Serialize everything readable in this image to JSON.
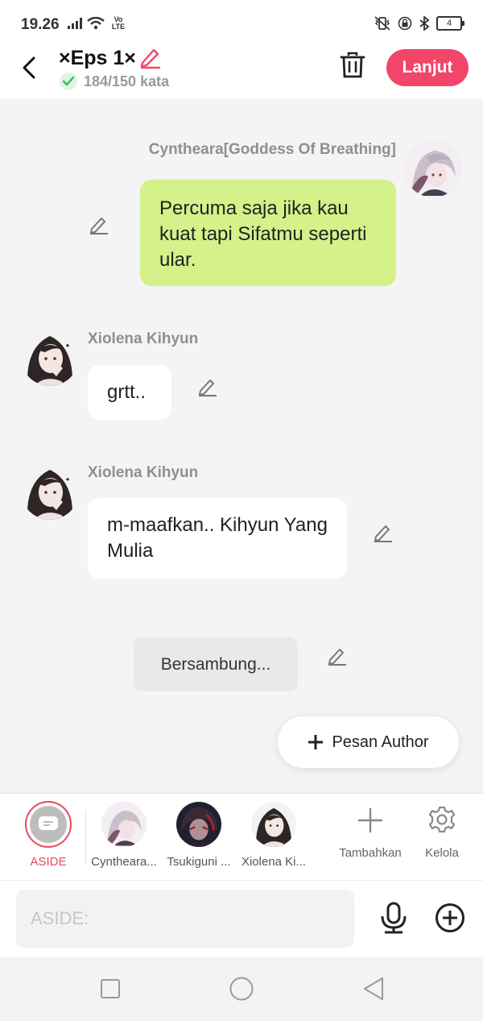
{
  "status_bar": {
    "time": "19.26",
    "network": "Vo LTE",
    "battery": "4"
  },
  "header": {
    "title": "×Eps 1×",
    "word_count": "184/150 kata",
    "next_label": "Lanjut",
    "accent_color": "#f2456a"
  },
  "messages": [
    {
      "sender": "Cyntheara[Goddess Of Breathing]",
      "text": "Percuma saja jika kau kuat tapi Sifatmu seperti ular.",
      "side": "right",
      "bubble_color": "#d4f18a"
    },
    {
      "sender": "Xiolena Kihyun",
      "text": "grtt..",
      "side": "left",
      "bubble_color": "#ffffff"
    },
    {
      "sender": "Xiolena Kihyun",
      "text": "m-maafkan.. Kihyun Yang Mulia",
      "side": "left",
      "bubble_color": "#ffffff"
    }
  ],
  "continue_label": "Bersambung...",
  "author_button_label": "Pesan Author",
  "characters": {
    "aside_label": "ASIDE",
    "items": [
      {
        "label": "Cyntheara..."
      },
      {
        "label": "Tsukiguni ..."
      },
      {
        "label": "Xiolena Ki..."
      }
    ],
    "add_label": "Tambahkan",
    "manage_label": "Kelola"
  },
  "input": {
    "placeholder": "ASIDE:"
  },
  "icons": {
    "back": "chevron-left-icon",
    "edit": "pencil-icon",
    "check": "check-icon",
    "trash": "trash-icon",
    "plus": "plus-icon",
    "gear": "gear-icon",
    "mic": "microphone-icon",
    "add_circle": "plus-circle-icon",
    "nav_recent": "square-icon",
    "nav_home": "circle-icon",
    "nav_back": "triangle-icon"
  }
}
